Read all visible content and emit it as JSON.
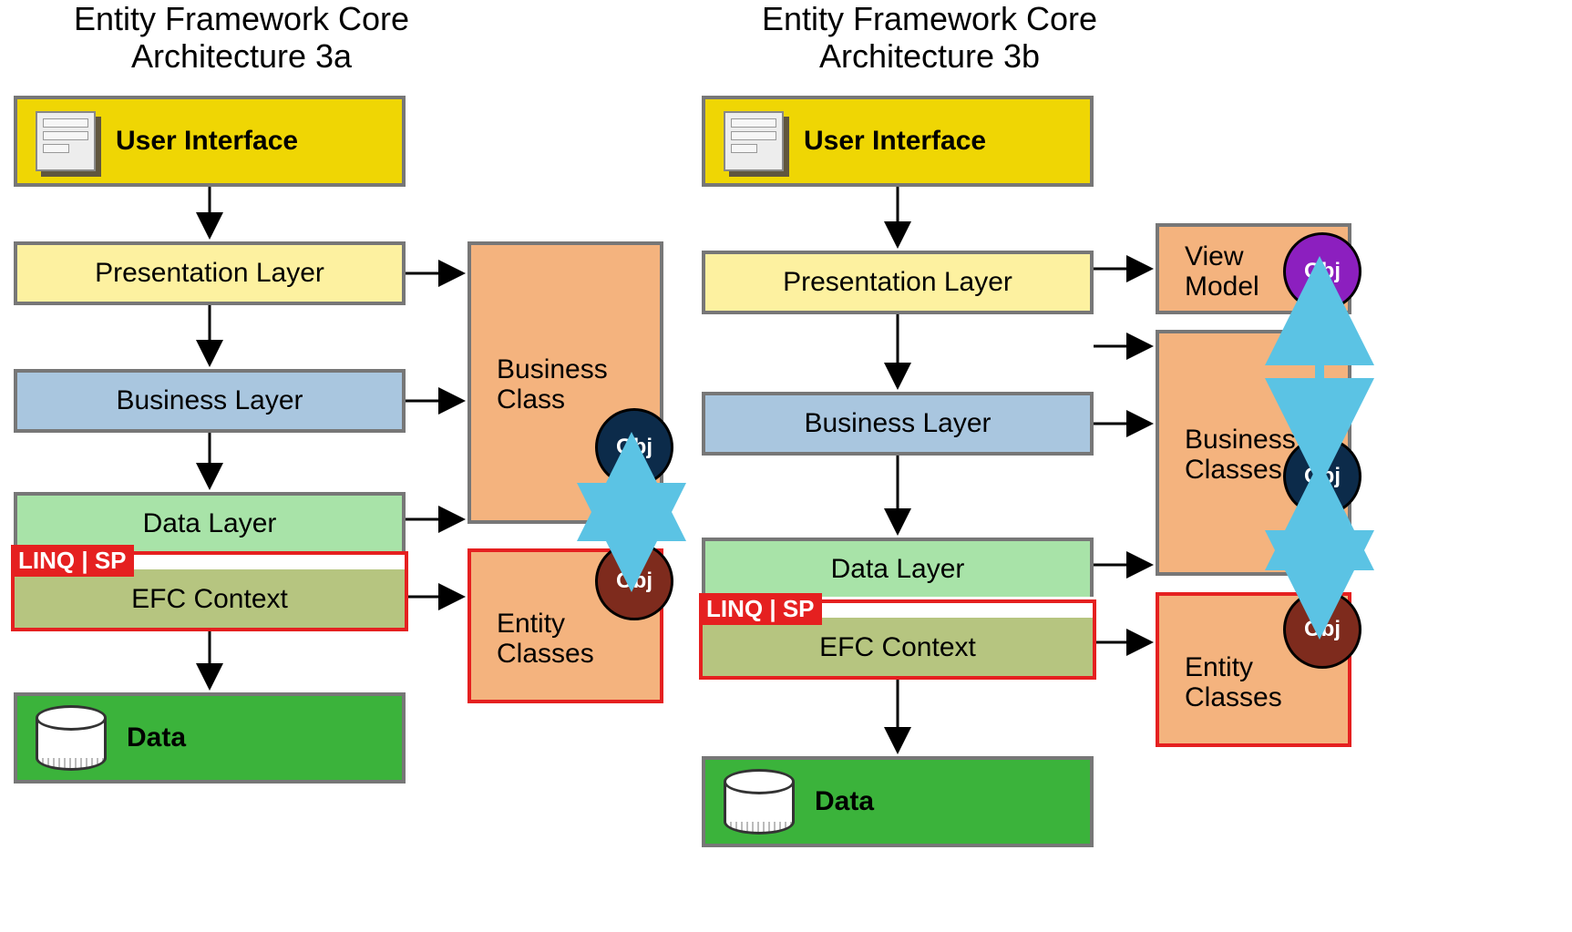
{
  "diagram": {
    "left": {
      "title_line1": "Entity Framework Core",
      "title_line2": "Architecture 3a",
      "ui": "User Interface",
      "presentation": "Presentation Layer",
      "business": "Business Layer",
      "data_layer": "Data Layer",
      "linq_sp": "LINQ | SP",
      "efc_context": "EFC Context",
      "data": "Data",
      "side": {
        "business_class": "Business\nClass",
        "entity_classes": "Entity\nClasses"
      },
      "obj": "Obj"
    },
    "right": {
      "title_line1": "Entity Framework Core",
      "title_line2": "Architecture 3b",
      "ui": "User Interface",
      "presentation": "Presentation Layer",
      "business": "Business Layer",
      "data_layer": "Data Layer",
      "linq_sp": "LINQ | SP",
      "efc_context": "EFC Context",
      "data": "Data",
      "side": {
        "view_model": "View\nModel",
        "business_classes": "Business\nClasses",
        "entity_classes": "Entity\nClasses"
      },
      "obj": "Obj"
    },
    "colors": {
      "yellow_deep": "#efd604",
      "yellow_light": "#fdf1a0",
      "blue_light": "#a9c6df",
      "green_light": "#a8e3a8",
      "olive": "#b6c580",
      "green_solid": "#3bb33b",
      "orange": "#f4b37e",
      "red": "#e52020",
      "arrow_blue": "#5bc3e4",
      "obj_navy": "#0c2b4a",
      "obj_brown": "#7e2b1d",
      "obj_purple": "#8c1fbf"
    }
  }
}
